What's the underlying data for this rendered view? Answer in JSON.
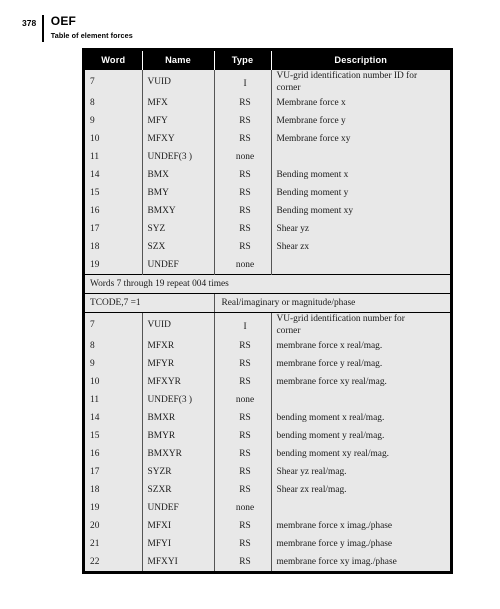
{
  "page": {
    "number": "378",
    "title": "OEF",
    "subtitle": "Table of element forces"
  },
  "table": {
    "columns": [
      "Word",
      "Name",
      "Type",
      "Description"
    ],
    "blocks": [
      {
        "rows": [
          {
            "word": "7",
            "name": "VUID",
            "type": "I",
            "desc": "VU-grid identification number ID for",
            "desc2": "corner",
            "tall": true
          },
          {
            "word": "8",
            "name": "MFX",
            "type": "RS",
            "desc": "Membrane force x"
          },
          {
            "word": "9",
            "name": "MFY",
            "type": "RS",
            "desc": "Membrane force y"
          },
          {
            "word": "10",
            "name": "MFXY",
            "type": "RS",
            "desc": "Membrane force xy"
          },
          {
            "word": "11",
            "name": "UNDEF(3 )",
            "type": "none",
            "desc": ""
          },
          {
            "word": "14",
            "name": "BMX",
            "type": "RS",
            "desc": "Bending moment x"
          },
          {
            "word": "15",
            "name": "BMY",
            "type": "RS",
            "desc": "Bending moment y"
          },
          {
            "word": "16",
            "name": "BMXY",
            "type": "RS",
            "desc": "Bending moment xy"
          },
          {
            "word": "17",
            "name": "SYZ",
            "type": "RS",
            "desc": "Shear yz"
          },
          {
            "word": "18",
            "name": "SZX",
            "type": "RS",
            "desc": "Shear zx"
          },
          {
            "word": "19",
            "name": "UNDEF",
            "type": "none",
            "desc": ""
          }
        ]
      }
    ],
    "repeat_note": "Words 7 through 19 repeat 004 times",
    "condition": {
      "left": "TCODE,7 =1",
      "right": "Real/imaginary or magnitude/phase"
    },
    "block2_rows": [
      {
        "word": "7",
        "name": "VUID",
        "type": "I",
        "desc": "VU-grid identification number for",
        "desc2": "corner",
        "tall": true
      },
      {
        "word": "8",
        "name": "MFXR",
        "type": "RS",
        "desc": "membrane force x real/mag."
      },
      {
        "word": "9",
        "name": "MFYR",
        "type": "RS",
        "desc": "membrane force y real/mag."
      },
      {
        "word": "10",
        "name": "MFXYR",
        "type": "RS",
        "desc": "membrane force xy real/mag."
      },
      {
        "word": "11",
        "name": "UNDEF(3 )",
        "type": "none",
        "desc": ""
      },
      {
        "word": "14",
        "name": "BMXR",
        "type": "RS",
        "desc": "bending moment x real/mag."
      },
      {
        "word": "15",
        "name": "BMYR",
        "type": "RS",
        "desc": "bending moment y real/mag."
      },
      {
        "word": "16",
        "name": "BMXYR",
        "type": "RS",
        "desc": "bending moment xy real/mag."
      },
      {
        "word": "17",
        "name": "SYZR",
        "type": "RS",
        "desc": "Shear yz real/mag."
      },
      {
        "word": "18",
        "name": "SZXR",
        "type": "RS",
        "desc": "Shear zx real/mag."
      },
      {
        "word": "19",
        "name": "UNDEF",
        "type": "none",
        "desc": ""
      },
      {
        "word": "20",
        "name": "MFXI",
        "type": "RS",
        "desc": "membrane force x imag./phase"
      },
      {
        "word": "21",
        "name": "MFYI",
        "type": "RS",
        "desc": "membrane force y imag./phase"
      },
      {
        "word": "22",
        "name": "MFXYI",
        "type": "RS",
        "desc": "membrane force xy imag./phase"
      }
    ]
  },
  "colors": {
    "header_bg": "#000000",
    "header_fg": "#ffffff",
    "cell_bg": "#e8e8e8",
    "border": "#000000"
  }
}
